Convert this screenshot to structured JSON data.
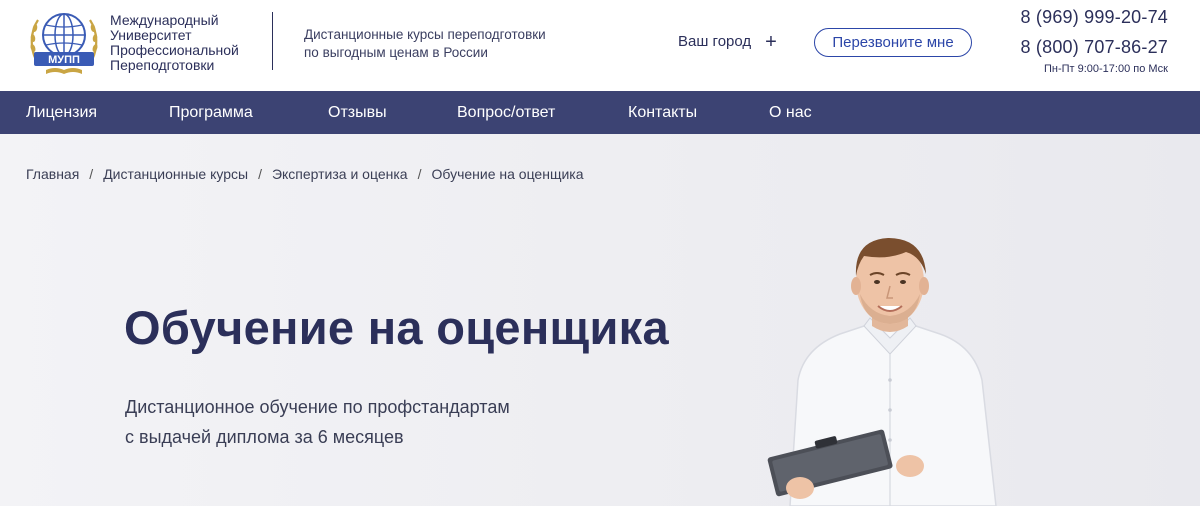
{
  "header": {
    "logo": {
      "badge_text": "МУПП",
      "name_lines": [
        "Международный",
        "Университет",
        "Профессиональной",
        "Переподготовки"
      ]
    },
    "tagline_lines": [
      "Дистанционные курсы переподготовки",
      "по выгодным ценам в России"
    ],
    "city_label": "Ваш город",
    "city_icon": "plus-icon",
    "callback_label": "Перезвоните мне",
    "phones": [
      "8 (969) 999-20-74",
      "8 (800) 707-86-27"
    ],
    "hours": "Пн-Пт 9:00-17:00 по Мск"
  },
  "nav": {
    "items": [
      "Лицензия",
      "Программа",
      "Отзывы",
      "Вопрос/ответ",
      "Контакты",
      "О нас"
    ]
  },
  "breadcrumb": {
    "items": [
      "Главная",
      "Дистанционные курсы",
      "Экспертиза и оценка",
      "Обучение на оценщика"
    ],
    "separator": "/"
  },
  "hero": {
    "title": "Обучение на оценщика",
    "subtitle_lines": [
      "Дистанционное обучение по профстандартам",
      "с выдачей диплома за 6 месяцев"
    ]
  },
  "colors": {
    "brand_dark": "#2b2f5a",
    "nav_bg": "#3c4373",
    "accent_blue": "#2c46a8",
    "logo_gold": "#c9a544"
  }
}
